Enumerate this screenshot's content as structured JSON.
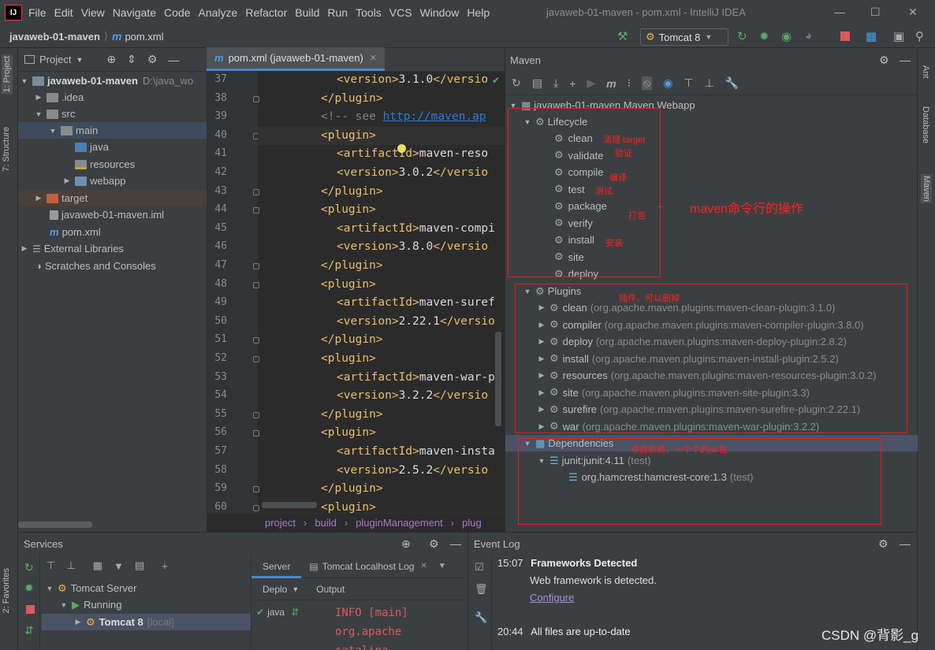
{
  "menubar": {
    "items": [
      "File",
      "Edit",
      "View",
      "Navigate",
      "Code",
      "Analyze",
      "Refactor",
      "Build",
      "Run",
      "Tools",
      "VCS",
      "Window",
      "Help"
    ],
    "title": "javaweb-01-maven - pom.xml - IntelliJ IDEA"
  },
  "navbar": {
    "project": "javaweb-01-maven",
    "file": "pom.xml",
    "run_config": "Tomcat 8"
  },
  "stripes": {
    "left": [
      "1: Project",
      "7: Structure",
      "2: Favorites"
    ],
    "right": [
      "Ant",
      "Database",
      "Maven"
    ]
  },
  "project_panel": {
    "header": "Project",
    "rows": [
      {
        "label": "javaweb-01-maven",
        "suffix": "D:\\java_wo"
      },
      {
        "label": ".idea"
      },
      {
        "label": "src"
      },
      {
        "label": "main"
      },
      {
        "label": "java"
      },
      {
        "label": "resources"
      },
      {
        "label": "webapp"
      },
      {
        "label": "target"
      },
      {
        "label": "javaweb-01-maven.iml"
      },
      {
        "label": "pom.xml"
      },
      {
        "label": "External Libraries"
      },
      {
        "label": "Scratches and Consoles"
      }
    ]
  },
  "editor": {
    "tab": "pom.xml (javaweb-01-maven)",
    "line_numbers": [
      "37",
      "38",
      "39",
      "40",
      "41",
      "42",
      "43",
      "44",
      "45",
      "46",
      "47",
      "48",
      "49",
      "50",
      "51",
      "52",
      "53",
      "54",
      "55",
      "56",
      "57",
      "58",
      "59",
      "60"
    ],
    "lines": [
      "<version>3.1.0</versio",
      "</plugin>",
      "<!-- see http://maven.ap",
      "<plugin>",
      "<artifactId>maven-reso",
      "<version>3.0.2</versio",
      "</plugin>",
      "<plugin>",
      "<artifactId>maven-compi",
      "<version>3.8.0</versio",
      "</plugin>",
      "<plugin>",
      "<artifactId>maven-suref",
      "<version>2.22.1</versio",
      "</plugin>",
      "<plugin>",
      "<artifactId>maven-war-p",
      "<version>3.2.2</versio",
      "</plugin>",
      "<plugin>",
      "<artifactId>maven-insta",
      "<version>2.5.2</versio",
      "</plugin>",
      "<plugin>"
    ],
    "breadcrumbs": [
      "project",
      "build",
      "pluginManagement",
      "plug"
    ]
  },
  "maven": {
    "header": "Maven",
    "root": "javaweb-01-maven Maven Webapp",
    "lifecycle_label": "Lifecycle",
    "lifecycle": [
      "clean",
      "validate",
      "compile",
      "test",
      "package",
      "verify",
      "install",
      "site",
      "deploy"
    ],
    "plugins_label": "Plugins",
    "plugins": [
      {
        "name": "clean",
        "coord": "(org.apache.maven.plugins:maven-clean-plugin:3.1.0)"
      },
      {
        "name": "compiler",
        "coord": "(org.apache.maven.plugins:maven-compiler-plugin:3.8.0)"
      },
      {
        "name": "deploy",
        "coord": "(org.apache.maven.plugins:maven-deploy-plugin:2.8.2)"
      },
      {
        "name": "install",
        "coord": "(org.apache.maven.plugins:maven-install-plugin:2.5.2)"
      },
      {
        "name": "resources",
        "coord": "(org.apache.maven.plugins:maven-resources-plugin:3.0.2)"
      },
      {
        "name": "site",
        "coord": "(org.apache.maven.plugins:maven-site-plugin:3.3)"
      },
      {
        "name": "surefire",
        "coord": "(org.apache.maven.plugins:maven-surefire-plugin:2.22.1)"
      },
      {
        "name": "war",
        "coord": "(org.apache.maven.plugins:maven-war-plugin:3.2.2)"
      }
    ],
    "dependencies_label": "Dependencies",
    "deps": [
      {
        "name": "junit:junit:4.11",
        "scope": "(test)"
      },
      {
        "name": "org.hamcrest:hamcrest-core:1.3",
        "scope": "(test)"
      }
    ],
    "annotations": {
      "clean": "清理 target",
      "validate": "验证",
      "compile": "编译",
      "test": "测试",
      "package": "打包",
      "install": "安装",
      "lifecycle_note": "maven命令行的操作",
      "plugins_note": "插件，可以删掉",
      "deps_note": "项目依赖，一个个的jar包"
    }
  },
  "services": {
    "header": "Services",
    "tomcat_server": "Tomcat Server",
    "running": "Running",
    "tomcat_instance": "Tomcat 8",
    "instance_suffix": "[local]",
    "tabs": [
      "Server",
      "Tomcat Localhost Log"
    ],
    "deploy_label": "Deplo",
    "output_label": "Output",
    "deploy_item": "java",
    "output_lines": [
      "INFO [main]",
      "org.apache",
      "catalina"
    ]
  },
  "event_log": {
    "header": "Event Log",
    "entries": [
      {
        "time": "15:07",
        "title": "Frameworks Detected",
        "body": "Web framework is detected.",
        "link": "Configure"
      },
      {
        "time": "20:44",
        "title": "All files are up-to-date"
      }
    ]
  },
  "watermark": "CSDN @背影_g",
  "colors": {
    "accent": "#4a88c7",
    "annotation": "#e02020",
    "run_green": "#59a869",
    "stop_red": "#db5860"
  }
}
